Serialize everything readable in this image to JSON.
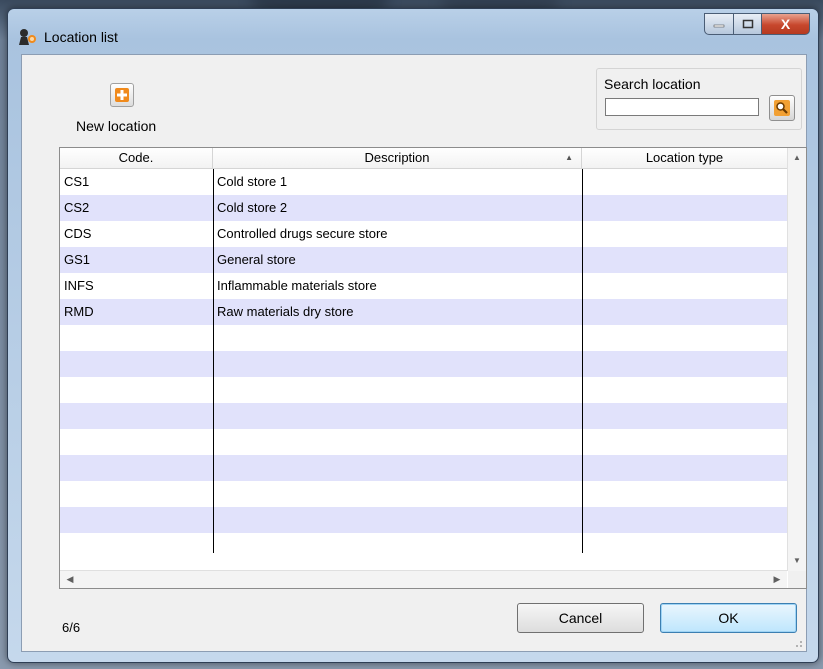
{
  "window": {
    "title": "Location list",
    "controls": {
      "minimize": "—",
      "maximize": "□",
      "close": "X"
    }
  },
  "toolbar": {
    "new_location_label": "New location"
  },
  "search": {
    "label": "Search location",
    "value": "",
    "placeholder": ""
  },
  "table": {
    "columns": [
      "Code.",
      "Description",
      "Location type"
    ],
    "sorted_column": "Description",
    "rows": [
      {
        "code": "CS1",
        "description": "Cold store 1",
        "location_type": ""
      },
      {
        "code": "CS2",
        "description": "Cold store 2",
        "location_type": ""
      },
      {
        "code": "CDS",
        "description": "Controlled drugs secure store",
        "location_type": ""
      },
      {
        "code": "GS1",
        "description": "General store",
        "location_type": ""
      },
      {
        "code": "INFS",
        "description": "Inflammable materials store",
        "location_type": ""
      },
      {
        "code": "RMD",
        "description": "Raw materials dry store",
        "location_type": ""
      }
    ],
    "empty_rows": 9,
    "alt_row_color": "#e1e2fb"
  },
  "footer": {
    "count": "6/6",
    "cancel_label": "Cancel",
    "ok_label": "OK"
  },
  "colors": {
    "accent_plus": "#f08a1c",
    "ok_button": "#bee6fd",
    "close_button": "#c7472d"
  }
}
